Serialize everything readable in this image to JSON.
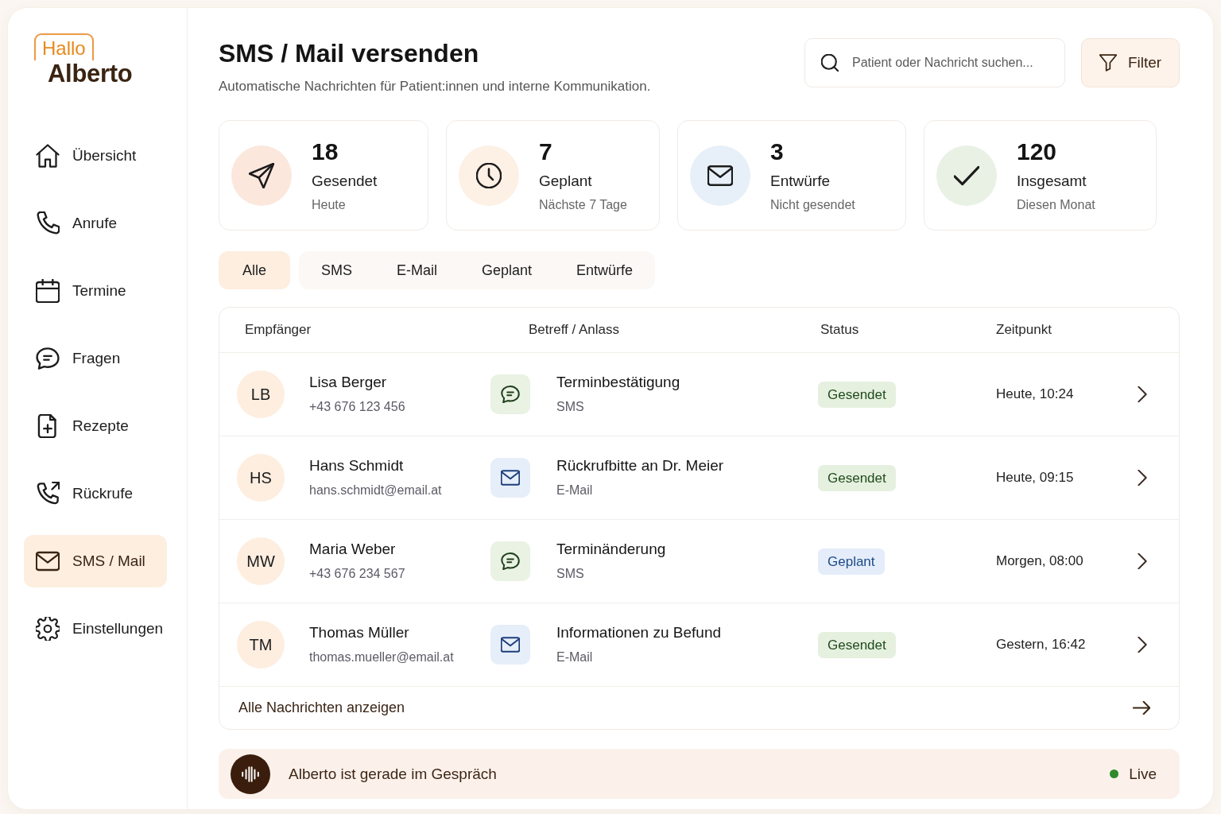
{
  "logo": {
    "greeting": "Hallo",
    "name": "Alberto"
  },
  "sidebar": {
    "items": [
      {
        "label": "Übersicht",
        "selected": false
      },
      {
        "label": "Anrufe",
        "selected": false
      },
      {
        "label": "Termine",
        "selected": false
      },
      {
        "label": "Fragen",
        "selected": false
      },
      {
        "label": "Rezepte",
        "selected": false
      },
      {
        "label": "Rückrufe",
        "selected": false
      },
      {
        "label": "SMS / Mail",
        "selected": true
      },
      {
        "label": "Einstellungen",
        "selected": false
      }
    ]
  },
  "header": {
    "title": "SMS / Mail versenden",
    "subtitle": "Automatische Nachrichten für Patient:innen und interne Kommunikation.",
    "search": {
      "placeholder": "Patient oder Nachricht suchen..."
    },
    "filter_button": "Filter"
  },
  "stats": [
    {
      "value": "18",
      "label": "Gesendet",
      "caption": "Heute",
      "color": "#fce7dd"
    },
    {
      "value": "7",
      "label": "Geplant",
      "caption": "Nächste 7 Tage",
      "color": "#fdf0e4"
    },
    {
      "value": "3",
      "label": "Entwürfe",
      "caption": "Nicht gesendet",
      "color": "#e7eff9"
    },
    {
      "value": "120",
      "label": "Insgesamt",
      "caption": "Diesen Monat",
      "color": "#e9f1e4"
    }
  ],
  "tabs": [
    {
      "label": "Alle",
      "selected": true
    },
    {
      "label": "SMS",
      "selected": false
    },
    {
      "label": "E-Mail",
      "selected": false
    },
    {
      "label": "Geplant",
      "selected": false
    },
    {
      "label": "Entwürfe",
      "selected": false
    }
  ],
  "table": {
    "columns": [
      "Empfänger",
      "Betreff / Anlass",
      "Status",
      "Zeitpunkt"
    ],
    "rows": [
      {
        "initials": "LB",
        "name": "Lisa Berger",
        "contact": "+43 676 123 456",
        "kind": "sms",
        "subject": "Terminbestätigung",
        "channel": "SMS",
        "status": {
          "label": "Gesendet",
          "kind": "sent"
        },
        "time": "Heute, 10:24"
      },
      {
        "initials": "HS",
        "name": "Hans Schmidt",
        "contact": "hans.schmidt@email.at",
        "kind": "mail",
        "subject": "Rückrufbitte an Dr. Meier",
        "channel": "E-Mail",
        "status": {
          "label": "Gesendet",
          "kind": "sent"
        },
        "time": "Heute, 09:15"
      },
      {
        "initials": "MW",
        "name": "Maria Weber",
        "contact": "+43 676 234 567",
        "kind": "sms",
        "subject": "Terminänderung",
        "channel": "SMS",
        "status": {
          "label": "Geplant",
          "kind": "scheduled"
        },
        "time": "Morgen, 08:00"
      },
      {
        "initials": "TM",
        "name": "Thomas Müller",
        "contact": "thomas.mueller@email.at",
        "kind": "mail",
        "subject": "Informationen zu Befund",
        "channel": "E-Mail",
        "status": {
          "label": "Gesendet",
          "kind": "sent"
        },
        "time": "Gestern, 16:42"
      }
    ],
    "footer_link": "Alle Nachrichten anzeigen"
  },
  "status_bar": {
    "text": "Alberto ist gerade im Gespräch",
    "live": true,
    "live_label": "Live"
  }
}
